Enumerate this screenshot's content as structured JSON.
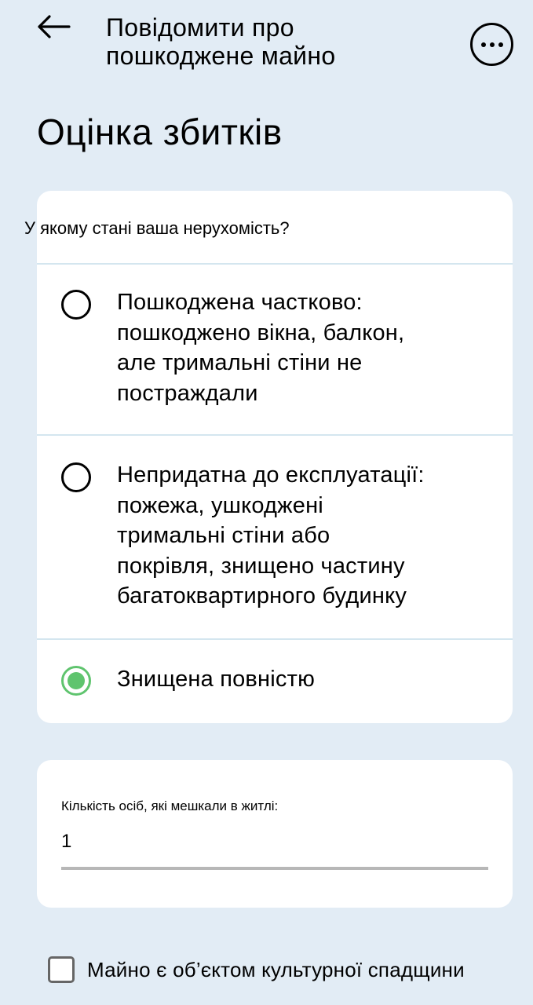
{
  "header": {
    "back_icon": "arrow-left-icon",
    "title_line1": "Повідомити про",
    "title_line2": "пошкоджене майно",
    "more_icon": "more-horizontal-icon"
  },
  "page_title": "Оцінка збитків",
  "property_state": {
    "question": "У якому стані ваша нерухомість?",
    "options": [
      {
        "lines": [
          "Пошкоджена частково:",
          "пошкоджено вікна, балкон,",
          "але тримальні стіни не",
          "постраждали"
        ],
        "selected": false
      },
      {
        "lines": [
          "Непридатна до експлуатації:",
          "пожежа, ушкоджені",
          "тримальні стіни або",
          "покрівля, знищено частину",
          "багатоквартирного будинку"
        ],
        "selected": false
      },
      {
        "lines": [
          "Знищена повністю"
        ],
        "selected": true
      }
    ]
  },
  "residents": {
    "label": "Кількість осіб, які мешкали в житлі:",
    "value": "1"
  },
  "heritage": {
    "label": "Майно є об’єктом культурної спадщини",
    "checked": false
  },
  "colors": {
    "background": "#e2ecf5",
    "accent": "#5fc46e",
    "divider": "#d4e6ef"
  }
}
